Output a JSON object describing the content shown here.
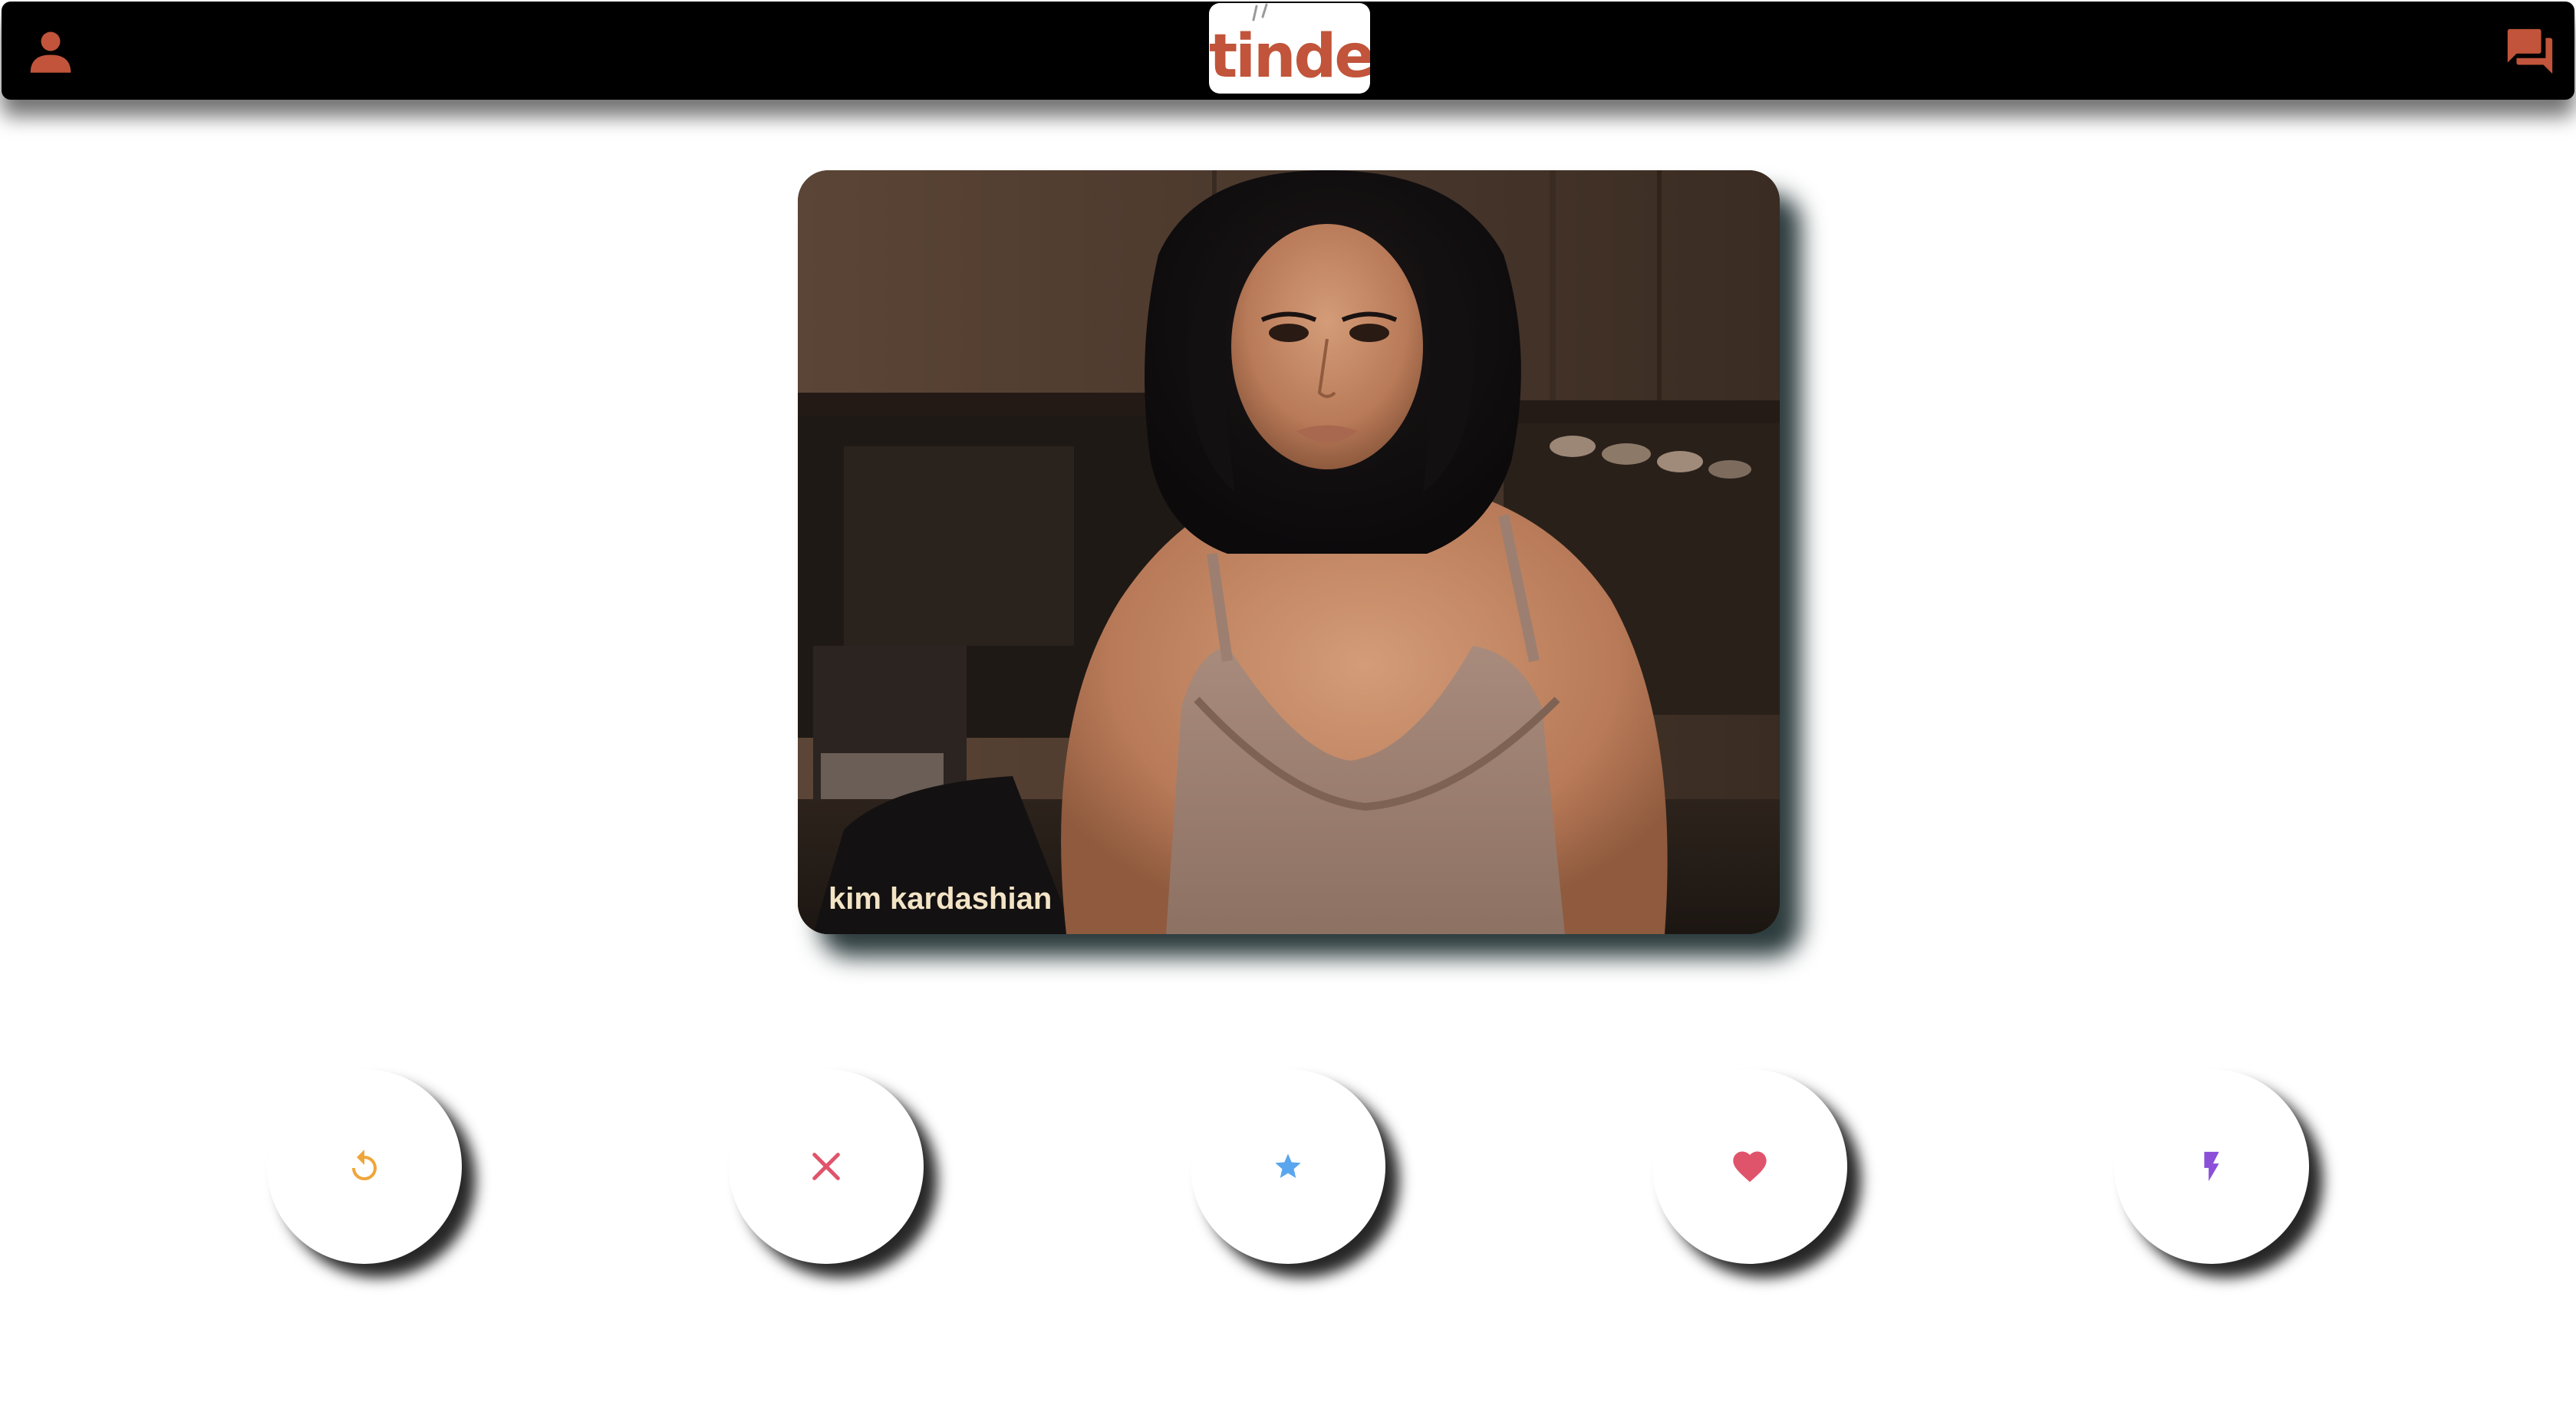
{
  "header": {
    "profile_icon": "person-icon",
    "chat_icon": "forum-icon",
    "logo_text": "tinder"
  },
  "colors": {
    "header_bg": "#000000",
    "accent": "#c1543a",
    "undo": "#f0a53a",
    "nope": "#e0546b",
    "superlike": "#5aa6ee",
    "like": "#e0546b",
    "boost": "#8b4fd8",
    "name_text": "#f3e4c6"
  },
  "card": {
    "name": "kim kardashian"
  },
  "actions": [
    {
      "id": "undo",
      "icon": "undo-icon"
    },
    {
      "id": "nope",
      "icon": "close-icon"
    },
    {
      "id": "superlike",
      "icon": "star-icon"
    },
    {
      "id": "like",
      "icon": "heart-icon"
    },
    {
      "id": "boost",
      "icon": "lightning-icon"
    }
  ]
}
